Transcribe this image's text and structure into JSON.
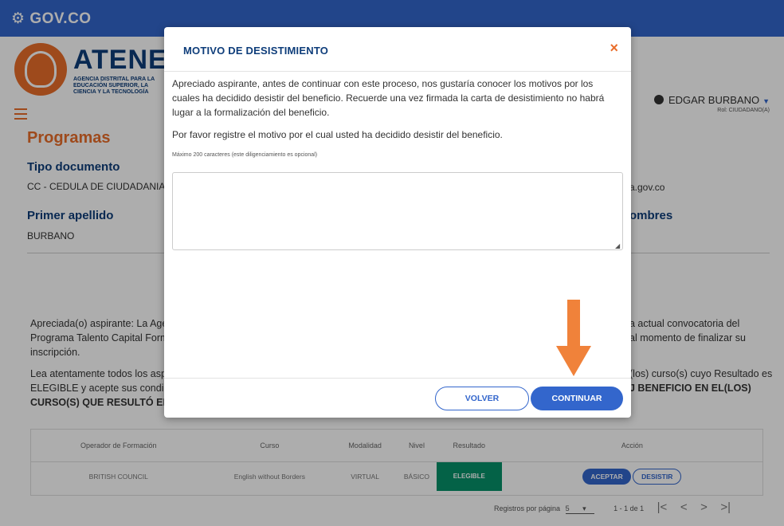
{
  "gov_bar": {
    "brand": "GOV.CO"
  },
  "header": {
    "logo_title": "ATENEA",
    "logo_subtitle": "AGENCIA DISTRITAL PARA LA EDUCACIÓN SUPERIOR, LA CIENCIA Y LA TECNOLOGÍA",
    "user_name": "EDGAR BURBANO",
    "user_role": "Rol: CIUDADANO(A)"
  },
  "page": {
    "title": "Programas",
    "tipo_documento_label": "Tipo documento",
    "tipo_documento_value": "CC - CEDULA DE CIUDADANIA",
    "email_partial": "a.gov.co",
    "primer_apellido_label": "Primer apellido",
    "primer_apellido_value": "BURBANO",
    "nombres_label_partial": "ombres",
    "para1_left": "Apreciada(o) aspirante: La Agen",
    "para1_left2": "Programa Talento Capital Forma",
    "para1_left3": "inscripción.",
    "para1_right": "a actual convocatoria del",
    "para1_right2": "al momento de finalizar su",
    "para2_left": "Lea atentamente todos los aspe",
    "para2_left2": "ELEGIBLE y acepte sus condicio",
    "para2_left3": "CURSO(S) QUE RESULTÓ ELEGI",
    "para2_right": "(los) curso(s) cuyo Resultado es",
    "para2_right2": "J BENEFICIO EN EL(LOS)"
  },
  "table": {
    "headers": [
      "Operador de Formación",
      "Curso",
      "Modalidad",
      "Nivel",
      "Resultado",
      "Acción"
    ],
    "row": {
      "operador": "BRITISH COUNCIL",
      "curso": "English without Borders",
      "modalidad": "VIRTUAL",
      "nivel": "BÁSICO",
      "resultado": "ELEGIBLE",
      "aceptar": "ACEPTAR",
      "desistir": "DESISTIR"
    }
  },
  "pager": {
    "label": "Registros por página",
    "per_page": "5",
    "range": "1 - 1 de 1",
    "first": "|<",
    "prev": "<",
    "next": ">",
    "last": ">|"
  },
  "modal": {
    "title": "MOTIVO DE DESISTIMIENTO",
    "close": "×",
    "paragraph1": "Apreciado aspirante, antes de continuar con este proceso, nos gustaría conocer los motivos por los cuales ha decidido desistir del beneficio. Recuerde una vez firmada la carta de desistimiento no habrá lugar a la formalización del beneficio.",
    "paragraph2": "Por favor registre el motivo por el cual usted ha decidido desistir del beneficio.",
    "hint": "Máximo 200 caracteres (este diligenciamiento es opcional)",
    "textarea_value": "",
    "btn_volver": "VOLVER",
    "btn_continuar": "CONTINUAR"
  },
  "colors": {
    "gov_blue": "#3366cc",
    "accent_orange": "#e96d2a",
    "navy": "#0e3d7a",
    "elegible_green": "#069169",
    "arrow_orange": "#f0823a"
  }
}
